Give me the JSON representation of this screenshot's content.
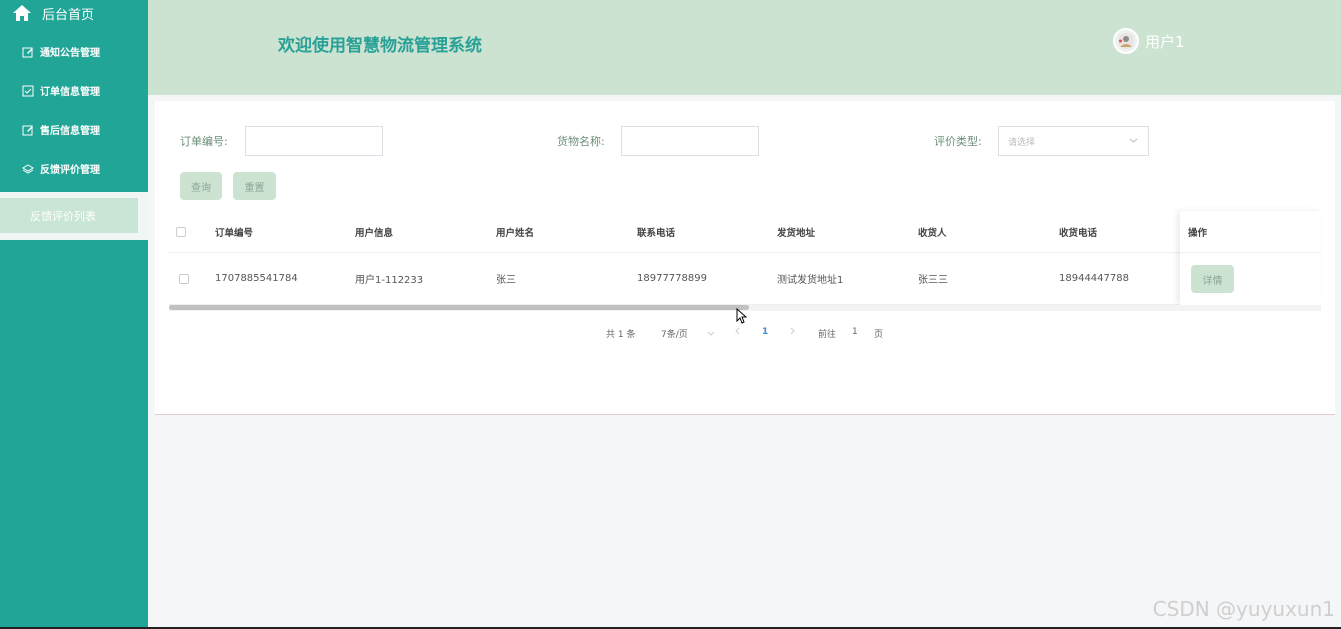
{
  "sidebar": {
    "home_label": "后台首页",
    "items": [
      {
        "label": "通知公告管理",
        "icon": "edit-icon"
      },
      {
        "label": "订单信息管理",
        "icon": "check-square-icon"
      },
      {
        "label": "售后信息管理",
        "icon": "edit-icon"
      },
      {
        "label": "反馈评价管理",
        "icon": "layers-icon"
      }
    ],
    "active_sub": "反馈评价列表"
  },
  "header": {
    "title": "欢迎使用智慧物流管理系统",
    "user_name": "用户1"
  },
  "filters": {
    "order_no_label": "订单编号:",
    "order_no_value": "",
    "goods_name_label": "货物名称:",
    "goods_name_value": "",
    "rating_type_label": "评价类型:",
    "rating_type_placeholder": "请选择",
    "query_button": "查询",
    "reset_button": "重置"
  },
  "table": {
    "columns": [
      "订单编号",
      "用户信息",
      "用户姓名",
      "联系电话",
      "发货地址",
      "收货人",
      "收货电话",
      "操作"
    ],
    "rows": [
      {
        "order_no": "1707885541784",
        "user_info": "用户1-112233",
        "user_name": "张三",
        "phone": "18977778899",
        "ship_address": "测试发货地址1",
        "receiver": "张三三",
        "receiver_phone": "18944447788",
        "action": "详情"
      }
    ]
  },
  "pagination": {
    "total": "共 1 条",
    "page_size": "7条/页",
    "current_page": "1",
    "goto_label": "前往",
    "goto_value": "1",
    "page_suffix": "页"
  },
  "watermark": "CSDN @yuyuxun1",
  "colors": {
    "sidebar": "#20a597",
    "header": "#cde3d1",
    "title": "#2aa197",
    "button": "#cde3d1",
    "active_page": "#3a8fd1"
  }
}
